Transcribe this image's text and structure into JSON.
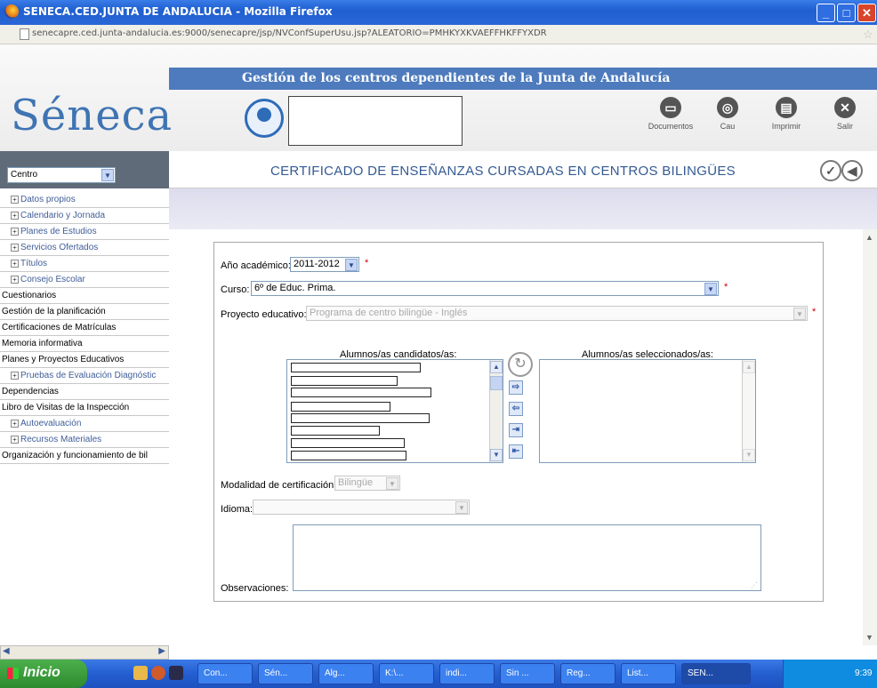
{
  "window": {
    "title": "SENECA.CED.JUNTA DE ANDALUCIA - Mozilla Firefox",
    "url": "senecapre.ced.junta-andalucia.es:9000/senecapre/jsp/NVConfSuperUsu.jsp?ALEATORIO=PMHKYXKVAEFFHKFFYXDR"
  },
  "header": {
    "band_title": "Gestión de los centros dependientes de la Junta de Andalucía",
    "logo": "Séneca",
    "buttons": [
      {
        "label": "Documentos",
        "icon": "document-icon"
      },
      {
        "label": "Cau",
        "icon": "help-icon"
      },
      {
        "label": "Imprimir",
        "icon": "printer-icon"
      },
      {
        "label": "Salir",
        "icon": "close-icon"
      }
    ]
  },
  "sidebar": {
    "selector_value": "Centro",
    "items": [
      {
        "label": "Datos propios",
        "expandable": true
      },
      {
        "label": "Calendario y Jornada",
        "expandable": true
      },
      {
        "label": "Planes de Estudios",
        "expandable": true
      },
      {
        "label": "Servicios Ofertados",
        "expandable": true
      },
      {
        "label": "Títulos",
        "expandable": true
      },
      {
        "label": "Consejo Escolar",
        "expandable": true
      },
      {
        "label": "Cuestionarios",
        "expandable": false
      },
      {
        "label": "Gestión de la planificación",
        "expandable": false
      },
      {
        "label": "Certificaciones de Matrículas",
        "expandable": false
      },
      {
        "label": "Memoria informativa",
        "expandable": false
      },
      {
        "label": "Planes y Proyectos Educativos",
        "expandable": false
      },
      {
        "label": "Pruebas de Evaluación Diagnóstic",
        "expandable": true
      },
      {
        "label": "Dependencias",
        "expandable": false
      },
      {
        "label": "Libro de Visitas de la Inspección",
        "expandable": false
      },
      {
        "label": "Autoevaluación",
        "expandable": true
      },
      {
        "label": "Recursos Materiales",
        "expandable": true
      },
      {
        "label": "Organización y funcionamiento de bil",
        "expandable": false
      }
    ]
  },
  "page": {
    "title": "CERTIFICADO DE ENSEÑANZAS CURSADAS EN CENTROS BILINGÜES"
  },
  "form": {
    "academic_year_label": "Año académico:",
    "academic_year_value": "2011-2012",
    "course_label": "Curso:",
    "course_value": "6º de Educ. Prima.",
    "project_label": "Proyecto educativo:",
    "project_value": "Programa de centro bilingüe - Inglés",
    "candidates_label": "Alumnos/as candidatos/as:",
    "selected_label": "Alumnos/as seleccionados/as:",
    "modality_label": "Modalidad de certificación:",
    "modality_value": "Bilingüe",
    "language_label": "Idioma:",
    "language_value": "",
    "observations_label": "Observaciones:",
    "required_mark": "*"
  },
  "taskbar": {
    "start_label": "Inicio",
    "items": [
      {
        "label": "Con..."
      },
      {
        "label": "Sén..."
      },
      {
        "label": "Alg..."
      },
      {
        "label": "K:\\..."
      },
      {
        "label": "indi..."
      },
      {
        "label": "Sin ..."
      },
      {
        "label": "Reg..."
      },
      {
        "label": "List..."
      },
      {
        "label": "SEN..."
      }
    ],
    "clock": "9:39"
  }
}
